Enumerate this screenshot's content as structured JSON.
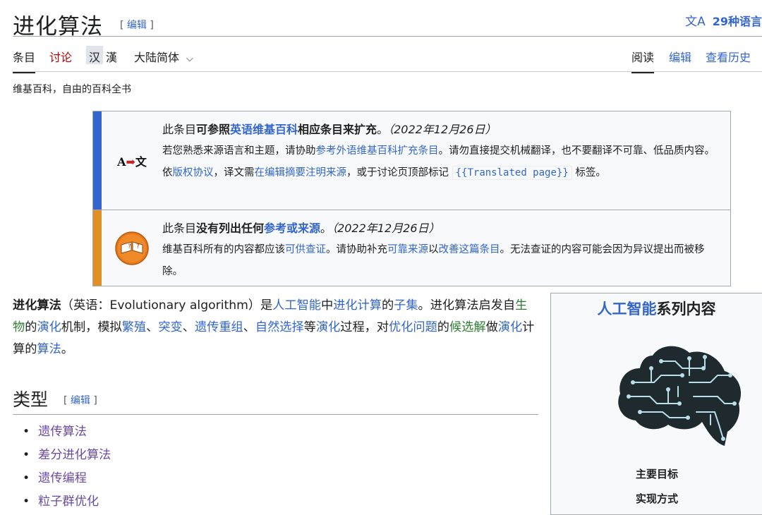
{
  "title": "进化算法",
  "edit_label": "编辑",
  "languages": "29种语言",
  "lang_icon": "文A",
  "tabs": {
    "article": "条目",
    "talk": "讨论",
    "variant_simplified": "汉",
    "variant_traditional": "漢",
    "region": "大陆简体",
    "read": "阅读",
    "edit": "编辑",
    "history": "查看历史"
  },
  "tagline": "维基百科，自由的百科全书",
  "notices": {
    "translate": {
      "icon": "A➡文",
      "t1": "此条目",
      "t2": "可参照",
      "t3": "英语维基百科",
      "t4": "相应条目来扩充",
      "t5": "。",
      "date": "（2022年12月26日）",
      "b1": "若您熟悉来源语言和主题，请协助",
      "b2": "参考外语维基百科扩充条目",
      "b3": "。请勿直接提交机械翻译，也不要翻译不可靠、低品质内容。依",
      "b4": "版权协议",
      "b5": "，译文需",
      "b6": "在编辑摘要注明来源",
      "b7": "，或于讨论页顶部标记",
      "code": "{{Translated page}}",
      "b8": "标签。",
      "bar_color": "#3366cc"
    },
    "refs": {
      "t1": "此条目",
      "t2": "没有列出任何",
      "t3": "参考或来源",
      "t4": "。",
      "date": "（2022年12月26日）",
      "b1": "维基百科所有的内容都应该",
      "b2": "可供查证",
      "b3": "。请协助补充",
      "b4": "可靠来源",
      "b5": "以",
      "b6": "改善这篇条目",
      "b7": "。无法查证的内容可能会因为异议提出而被移除。",
      "bar_color": "#e08e27"
    }
  },
  "lead": {
    "s1": "进化算法",
    "s2": "（英语：Evolutionary algorithm）是",
    "l1": "人工智能",
    "s3": "中",
    "l2": "进化计算",
    "s4": "的",
    "l3": "子集",
    "s5": "。进化算法启发自",
    "l4": "生物",
    "s6": "的",
    "l5": "演化",
    "s7": "机制，模拟",
    "l6": "繁殖",
    "s8": "、",
    "l7": "突变",
    "s9": "、",
    "l8": "遗传重组",
    "s10": "、",
    "l9": "自然选择",
    "s11": "等",
    "l10": "演化",
    "s12": "过程，对",
    "l11": "优化问题",
    "s13": "的",
    "l12": "候选解",
    "s14": "做",
    "l13": "演化",
    "s15": "计算的",
    "l14": "算法",
    "s16": "。"
  },
  "section": {
    "title": "类型",
    "items": [
      "遗传算法",
      "差分进化算法",
      "遗传编程",
      "粒子群优化"
    ]
  },
  "infobox": {
    "title_link": "人工智能",
    "title_rest": "系列内容",
    "row1": "主要目标",
    "row2": "实现方式"
  }
}
